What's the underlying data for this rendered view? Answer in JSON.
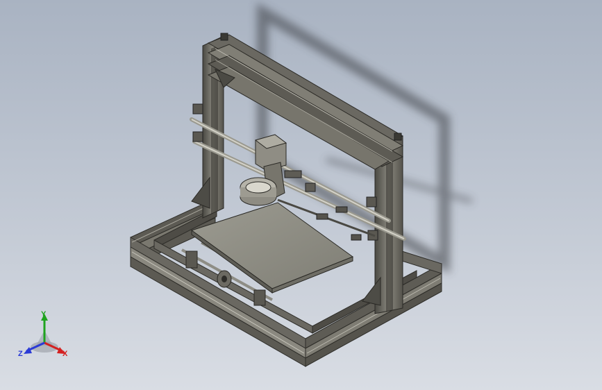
{
  "viewport": {
    "background_top": "#a9b3c2",
    "background_bottom": "#d9dde4"
  },
  "model": {
    "frame_color": "#6e6c63",
    "frame_dark": "#3c3b36",
    "bed_color": "#8f8e84",
    "shadow_color": "#5e6168"
  },
  "triad": {
    "y_label": "Y",
    "x_label": "X",
    "z_label": "Z",
    "y_color": "#1fa31f",
    "x_color": "#d42020",
    "z_color": "#2a3ad6"
  }
}
